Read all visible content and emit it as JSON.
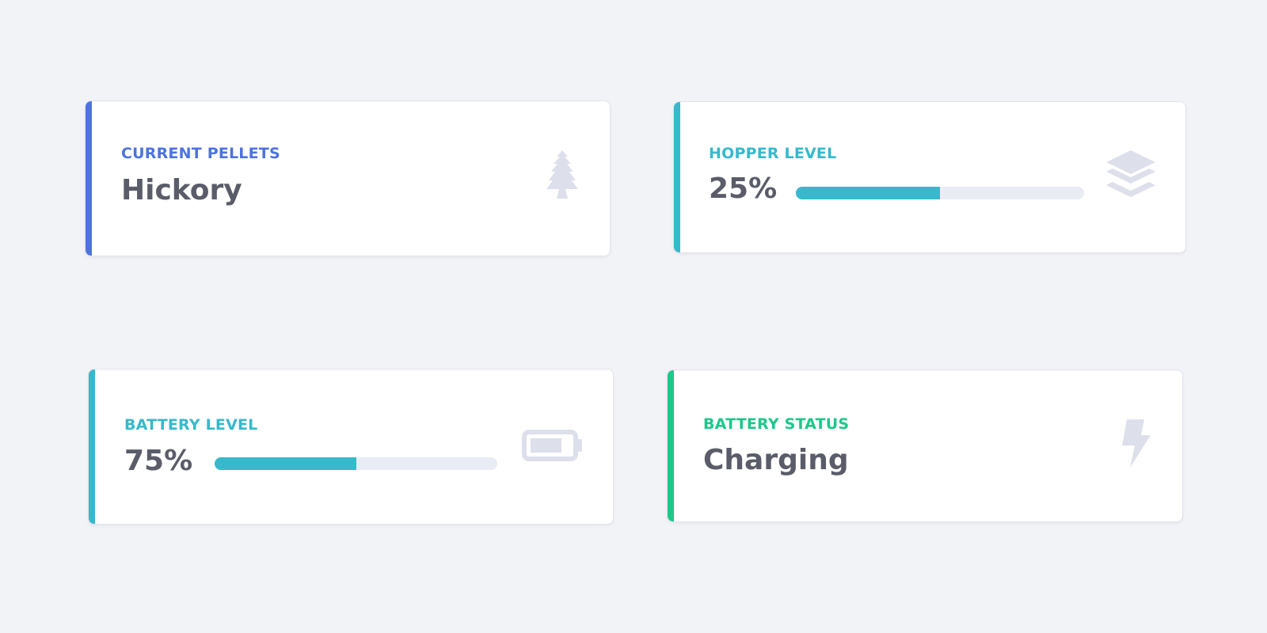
{
  "colors": {
    "primary": "#4e73df",
    "info": "#36b9cc",
    "success": "#1cc88a",
    "value_text": "#5a5c69",
    "icon_gray": "#dddfeb",
    "track": "#eaecf4"
  },
  "cards": [
    {
      "label": "CURRENT PELLETS",
      "value": "Hickory",
      "accent": "#4e73df",
      "icon": "tree-icon"
    },
    {
      "label": "HOPPER LEVEL",
      "value": "25%",
      "accent": "#36b9cc",
      "icon": "layer-group-icon",
      "progress_percent": 50
    },
    {
      "label": "BATTERY LEVEL",
      "value": "75%",
      "accent": "#36b9cc",
      "icon": "battery-three-quarters-icon",
      "progress_percent": 50
    },
    {
      "label": "BATTERY STATUS",
      "value": "Charging",
      "accent": "#1cc88a",
      "icon": "bolt-icon"
    }
  ]
}
